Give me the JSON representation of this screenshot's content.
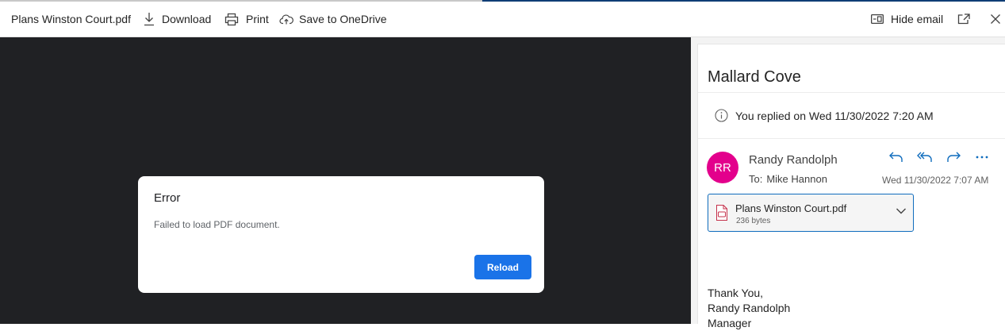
{
  "toolbar": {
    "file_name": "Plans Winston Court.pdf",
    "download_label": "Download",
    "print_label": "Print",
    "onedrive_label": "Save to OneDrive",
    "hide_email_label": "Hide email"
  },
  "loading": {
    "progress": 0.48
  },
  "error_dialog": {
    "title": "Error",
    "message": "Failed to load PDF document.",
    "reload_label": "Reload",
    "accent_color": "#1a73e8"
  },
  "email": {
    "subject": "Mallard Cove",
    "replied_notice": "You replied on Wed 11/30/2022 7:20 AM",
    "sender": {
      "initials": "RR",
      "name": "Randy Randolph",
      "avatar_color": "#e3008c"
    },
    "to_label": "To:",
    "to_name": "Mike Hannon",
    "date": "Wed 11/30/2022 7:07 AM",
    "attachment": {
      "name": "Plans Winston Court.pdf",
      "size": "236 bytes",
      "icon": "pdf-file-icon"
    },
    "body_lines": [
      "Thank You,",
      "Randy Randolph",
      "Manager"
    ]
  },
  "icons": {
    "download": "download-icon",
    "print": "printer-icon",
    "onedrive": "cloud-upload-icon",
    "hide_email": "hide-pane-icon",
    "popout": "pop-out-icon",
    "close": "close-icon",
    "info": "info-icon",
    "reply": "reply-icon",
    "reply_all": "reply-all-icon",
    "forward": "forward-icon",
    "more": "more-icon",
    "expand": "chevron-down-icon"
  }
}
